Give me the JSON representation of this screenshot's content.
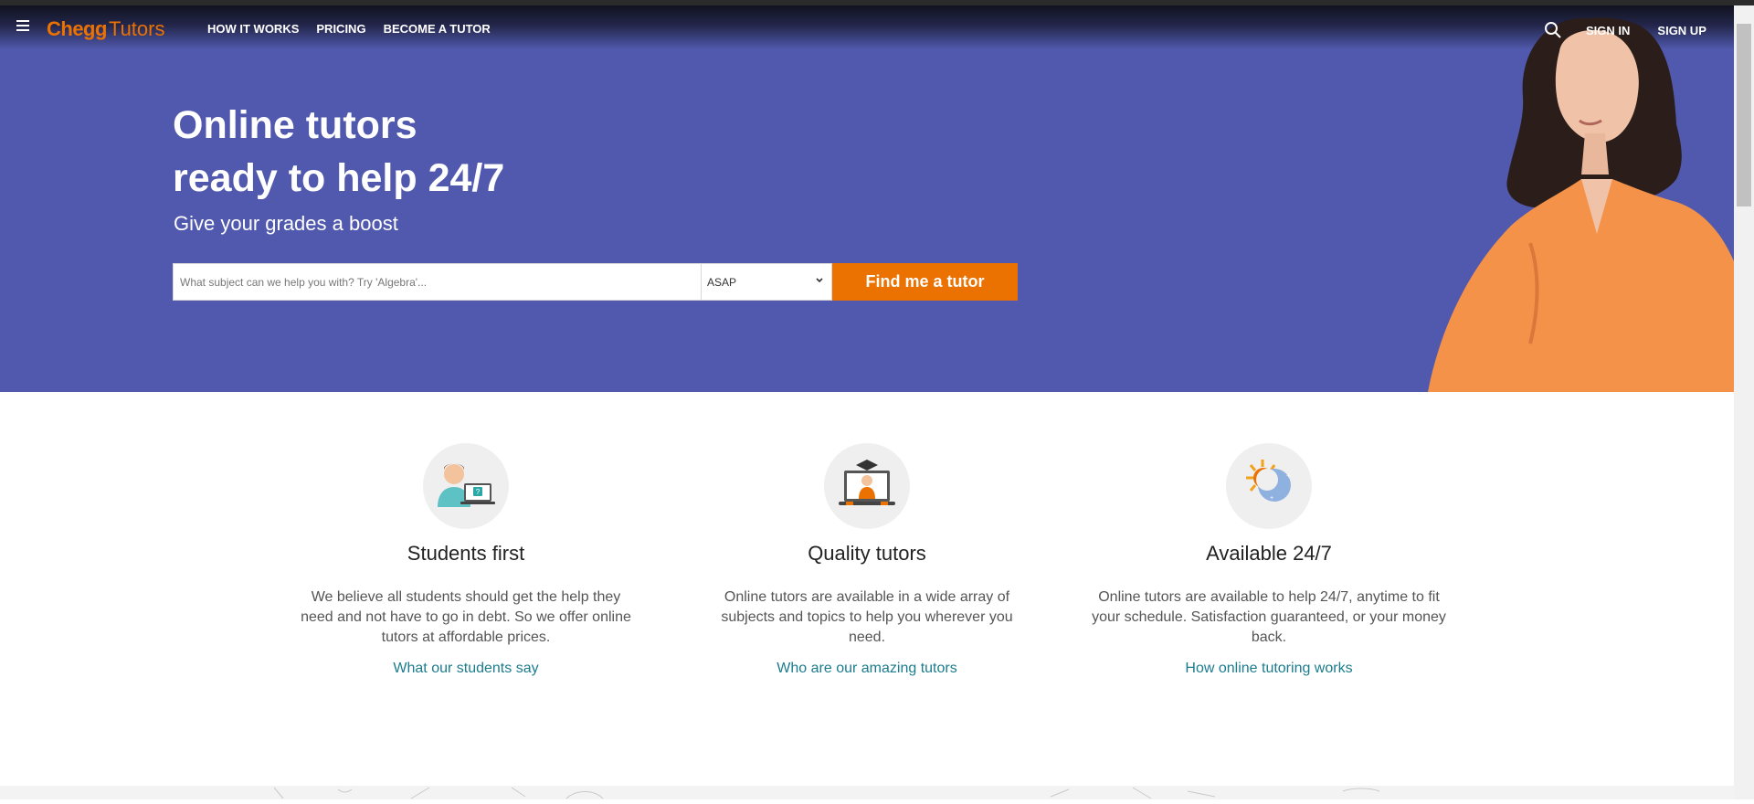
{
  "nav": {
    "logo_brand": "Chegg",
    "logo_product": "Tutors",
    "links": [
      "HOW IT WORKS",
      "PRICING",
      "BECOME A TUTOR"
    ],
    "sign_in": "SIGN IN",
    "sign_up": "SIGN UP",
    "icons": [
      "menu-icon",
      "search-icon"
    ]
  },
  "hero": {
    "headline_line1": "Online tutors",
    "headline_line2": "ready to help 24/7",
    "subheadline": "Give your grades a boost",
    "search_placeholder": "What subject can we help you with? Try 'Algebra'...",
    "search_value": "",
    "when_selected": "ASAP",
    "cta_label": "Find me a tutor",
    "colors": {
      "background": "#5059ad",
      "accent": "#eb7100"
    }
  },
  "features": [
    {
      "icon": "student-laptop-icon",
      "title": "Students first",
      "body": "We believe all students should get the help they need and not have to go in debt. So we offer online tutors at affordable prices.",
      "link": "What our students say"
    },
    {
      "icon": "graduate-tutor-icon",
      "title": "Quality tutors",
      "body": "Online tutors are available in a wide array of subjects and topics to help you wherever you need.",
      "link": "Who are our amazing tutors"
    },
    {
      "icon": "sun-moon-icon",
      "title": "Available 24/7",
      "body": "Online tutors are available to help 24/7, anytime to fit your schedule. Satisfaction guaranteed, or your money back.",
      "link": "How online tutoring works"
    }
  ],
  "link_color": "#1b7c8d"
}
